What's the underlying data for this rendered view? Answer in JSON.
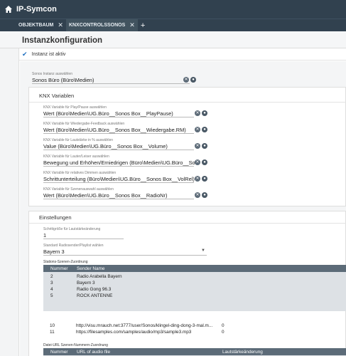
{
  "app": {
    "brand": "IP-Symcon"
  },
  "tabs": [
    {
      "label": "OBJEKTBAUM"
    },
    {
      "label": "KNXCONTROLSSONOS"
    }
  ],
  "page": {
    "title": "Instanzkonfiguration",
    "status": "Instanz ist aktiv"
  },
  "sonos": {
    "label": "Sonos Instanz auswählen",
    "value": "Sonos Büro (Büro\\Medien)"
  },
  "knx": {
    "title": "KNX Variablen",
    "fields": [
      {
        "label": "KNX Variable für Play/Pause auswählen",
        "value": "Wert (Büro\\Medien\\UG.Büro__Sonos Box__PlayPause)"
      },
      {
        "label": "KNX Variable für Wiedergabe-Feedback auswählen",
        "value": "Wert (Büro\\Medien\\UG.Büro__Sonos Box__Wiedergabe.RM)"
      },
      {
        "label": "KNX Variable für Lautstärke in % auswählen",
        "value": "Value (Büro\\Medien\\UG.Büro__Sonos Box__Volume)"
      },
      {
        "label": "KNX Variable für Lauter/Leiser auswählen",
        "value": "Bewegung und Erhöhen/Erniedrigen (Büro\\Medien\\UG.Büro__Sonos Box__Vol"
      },
      {
        "label": "KNX Variable für relatives Dimmen auswählen",
        "value": "Schrittunterteilung (Büro\\Medien\\UG.Büro__Sonos Box__VolRel)"
      },
      {
        "label": "KNX Variable für Szenenauswahl auswählen",
        "value": "Wert (Büro\\Medien\\UG.Büro__Sonos Box__RadioNr)"
      }
    ]
  },
  "settings": {
    "title": "Einstellungen",
    "step_label": "Schrittgröße für Lautstärkeänderung",
    "step_value": "1",
    "radio_label": "Standard Radiosender/Playlist wählen",
    "radio_value": "Bayern 3",
    "stations": {
      "caption": "Stations-Szenen-Zuordnung",
      "headers": [
        "Nummer",
        "Sender Name"
      ],
      "rows": [
        [
          "2",
          "Radio Arabella Bayern"
        ],
        [
          "3",
          "Bayern 3"
        ],
        [
          "4",
          "Radio Gong 96.3"
        ],
        [
          "5",
          "ROCK ANTENNE"
        ]
      ]
    },
    "files": {
      "caption": "Datei-URL Szenen-Nummern-Zuordnung",
      "headers": [
        "Nummer",
        "URL of audio file",
        "Lautstärkeänderung"
      ],
      "rows": [
        [
          "10",
          "http://visu.mrauch.net:3777/user/Sonos/klingel-ding-dong-3-mal.m...",
          "0"
        ],
        [
          "11",
          "https://filesamples.com/samples/audio/mp3/sample3.mp3",
          "0"
        ]
      ]
    }
  },
  "colors": {
    "topbar": "#31414f",
    "accent": "#1e6fbf",
    "table_header": "#5c6b78"
  }
}
